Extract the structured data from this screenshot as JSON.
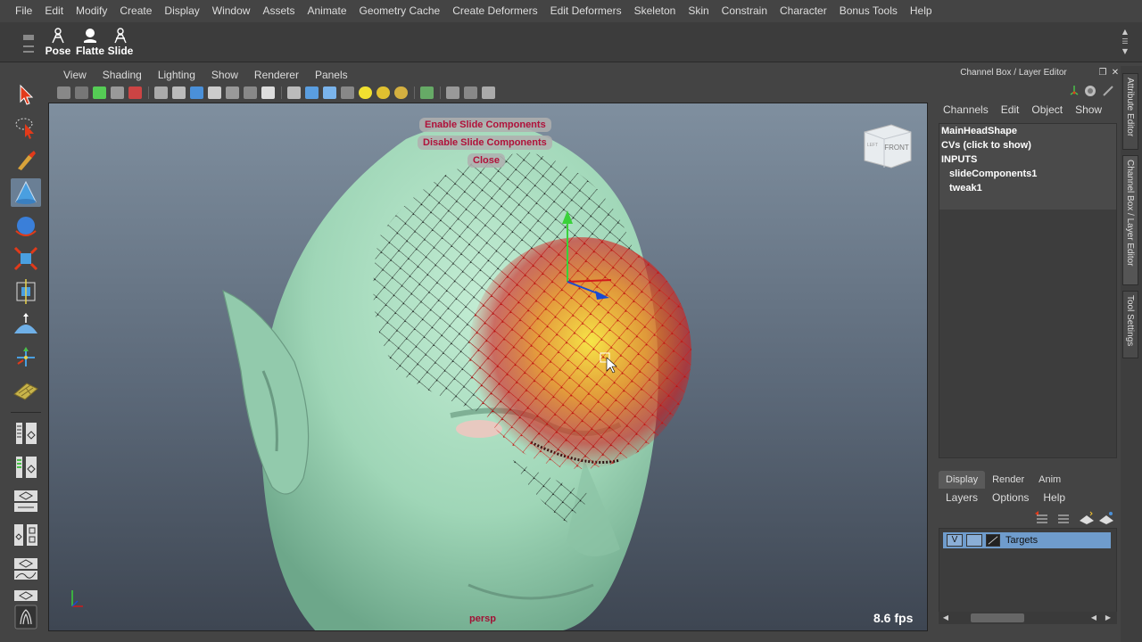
{
  "menubar": {
    "items": [
      "File",
      "Edit",
      "Modify",
      "Create",
      "Display",
      "Window",
      "Assets",
      "Animate",
      "Geometry Cache",
      "Create Deformers",
      "Edit Deformers",
      "Skeleton",
      "Skin",
      "Constrain",
      "Character",
      "Bonus Tools",
      "Help"
    ]
  },
  "shelf": {
    "tools": [
      {
        "label": "Pose",
        "icon": "pose-icon"
      },
      {
        "label": "Flatte",
        "icon": "flatten-icon"
      },
      {
        "label": "Slide",
        "icon": "slide-icon"
      }
    ]
  },
  "toolbox": {
    "tools": [
      "select-tool-icon",
      "lasso-tool-icon",
      "paint-select-tool-icon",
      "soft-select-tool-icon",
      "rotate-tool-icon",
      "scale-tool-icon",
      "universal-manipulator-icon",
      "soft-modification-icon",
      "show-manipulator-icon",
      "last-tool-icon"
    ],
    "layouts": [
      "layout-single-icon",
      "layout-two-panes-icon",
      "layout-outliner-icon",
      "layout-hypergraph-icon",
      "layout-graph-editor-icon",
      "layout-uv-icon"
    ]
  },
  "panel": {
    "menu": [
      "View",
      "Shading",
      "Lighting",
      "Show",
      "Renderer",
      "Panels"
    ]
  },
  "viewport": {
    "marking_menu": {
      "enable": "Enable Slide Components",
      "disable": "Disable Slide Components",
      "close": "Close"
    },
    "viewcube_label": "FRONT",
    "viewcube_side": "LEFT",
    "camera": "persp",
    "fps": "8.6 fps",
    "colors": {
      "skin": "#a5dcbf",
      "accent": "#a11236",
      "cv_hot": "#ffd21a",
      "cv_warm": "#e23a1a"
    }
  },
  "channel_box": {
    "title": "Channel Box / Layer Editor",
    "menu": [
      "Channels",
      "Edit",
      "Object",
      "Show"
    ],
    "shape": "MainHeadShape",
    "cvs": "CVs (click to show)",
    "inputs_label": "INPUTS",
    "inputs": [
      "slideComponents1",
      "tweak1"
    ]
  },
  "side_tabs": [
    "Attribute Editor",
    "Channel Box / Layer Editor",
    "Tool Settings"
  ],
  "layer_editor": {
    "tabs": [
      "Display",
      "Render",
      "Anim"
    ],
    "active_tab": "Display",
    "menu": [
      "Layers",
      "Options",
      "Help"
    ],
    "layer": {
      "visible": "V",
      "name": "Targets"
    }
  }
}
